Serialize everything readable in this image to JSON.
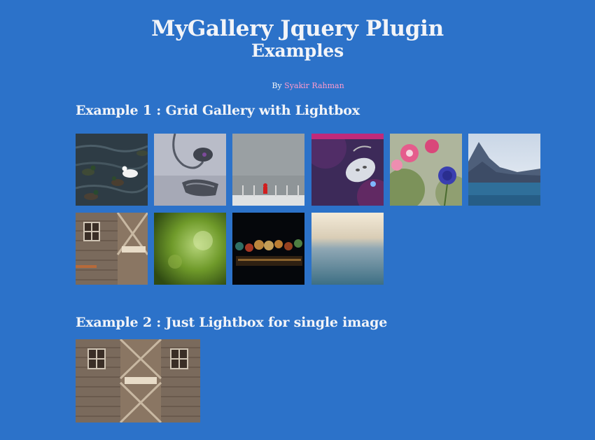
{
  "header": {
    "title": "MyGallery Jquery Plugin",
    "subtitle": "Examples"
  },
  "byline": {
    "prefix": "By",
    "author": "Syakir Rahman"
  },
  "colors": {
    "background": "#2c72c9",
    "text": "#f2f4f8",
    "author_link": "#ff9acb"
  },
  "example1": {
    "heading": "Example 1 : Grid Gallery with Lightbox",
    "images": [
      {
        "name": "ducks-photo"
      },
      {
        "name": "earrings-photo"
      },
      {
        "name": "pins-photo"
      },
      {
        "name": "pendant-photo"
      },
      {
        "name": "flowers-photo"
      },
      {
        "name": "mountain-lake-photo"
      },
      {
        "name": "barn-door-photo"
      },
      {
        "name": "green-bokeh-photo"
      },
      {
        "name": "night-lights-photo"
      },
      {
        "name": "blurred-sea-photo"
      }
    ]
  },
  "example2": {
    "heading": "Example 2 : Just Lightbox for single image",
    "image": {
      "name": "barn-door-wide-photo"
    }
  }
}
